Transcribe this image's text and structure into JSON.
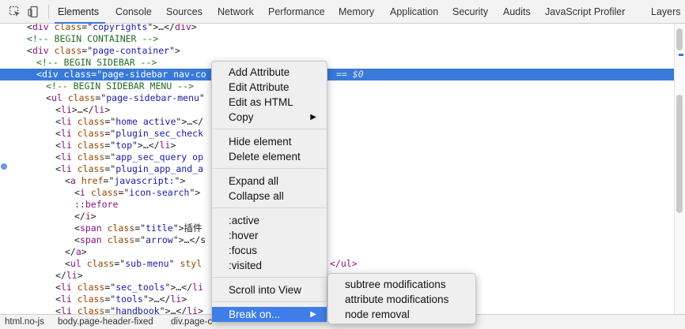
{
  "toolbar": {
    "tabs": [
      {
        "label": "Elements"
      },
      {
        "label": "Console"
      },
      {
        "label": "Sources"
      },
      {
        "label": "Network"
      },
      {
        "label": "Performance"
      },
      {
        "label": "Memory"
      },
      {
        "label": "Application"
      },
      {
        "label": "Security"
      },
      {
        "label": "Audits"
      },
      {
        "label": "JavaScript Profiler"
      },
      {
        "label": "Layers"
      }
    ],
    "active_tab": "Elements",
    "icons": [
      "inspect-element-icon",
      "device-toolbar-icon"
    ]
  },
  "tree": {
    "selected_suffix": "== $0",
    "lines": [
      {
        "tw": "▶",
        "parts": [
          [
            "p",
            "<"
          ],
          [
            "t",
            "div"
          ],
          [
            "p",
            " "
          ],
          [
            "a",
            "class"
          ],
          [
            "p",
            "=\""
          ],
          [
            "v",
            "copyrights"
          ],
          [
            "p",
            "\">…</"
          ],
          [
            "t",
            "div"
          ],
          [
            "p",
            ">"
          ]
        ]
      },
      {
        "tw": "",
        "parts": [
          [
            "c",
            "<!-- BEGIN CONTAINER -->"
          ]
        ]
      },
      {
        "tw": "▼",
        "parts": [
          [
            "p",
            "<"
          ],
          [
            "t",
            "div"
          ],
          [
            "p",
            " "
          ],
          [
            "a",
            "class"
          ],
          [
            "p",
            "=\""
          ],
          [
            "v",
            "page-container"
          ],
          [
            "p",
            "\">"
          ]
        ]
      },
      {
        "tw": "",
        "parts": [
          [
            "c",
            "<!-- BEGIN SIDEBAR -->"
          ]
        ]
      },
      {
        "tw": "▼",
        "parts": [
          [
            "p",
            "<"
          ],
          [
            "t",
            "div"
          ],
          [
            "p",
            " "
          ],
          [
            "a",
            "class"
          ],
          [
            "p",
            "=\""
          ],
          [
            "v",
            "page-sidebar nav-co"
          ]
        ]
      },
      {
        "tw": "",
        "parts": [
          [
            "c",
            "<!-- BEGIN SIDEBAR MENU -->"
          ]
        ]
      },
      {
        "tw": "▼",
        "parts": [
          [
            "p",
            "<"
          ],
          [
            "t",
            "ul"
          ],
          [
            "p",
            " "
          ],
          [
            "a",
            "class"
          ],
          [
            "p",
            "=\""
          ],
          [
            "v",
            "page-sidebar-menu"
          ],
          [
            "p",
            "\""
          ]
        ]
      },
      {
        "tw": "▶",
        "parts": [
          [
            "p",
            "<"
          ],
          [
            "t",
            "li"
          ],
          [
            "p",
            ">…</"
          ],
          [
            "t",
            "li"
          ],
          [
            "p",
            ">"
          ]
        ]
      },
      {
        "tw": "▶",
        "parts": [
          [
            "p",
            "<"
          ],
          [
            "t",
            "li"
          ],
          [
            "p",
            " "
          ],
          [
            "a",
            "class"
          ],
          [
            "p",
            "=\""
          ],
          [
            "v",
            "home active"
          ],
          [
            "p",
            "\">…</"
          ]
        ]
      },
      {
        "tw": "▶",
        "parts": [
          [
            "p",
            "<"
          ],
          [
            "t",
            "li"
          ],
          [
            "p",
            " "
          ],
          [
            "a",
            "class"
          ],
          [
            "p",
            "=\""
          ],
          [
            "v",
            "plugin_sec_check"
          ]
        ]
      },
      {
        "tw": "▶",
        "parts": [
          [
            "p",
            "<"
          ],
          [
            "t",
            "li"
          ],
          [
            "p",
            " "
          ],
          [
            "a",
            "class"
          ],
          [
            "p",
            "=\""
          ],
          [
            "v",
            "top"
          ],
          [
            "p",
            "\">…</"
          ],
          [
            "t",
            "li"
          ],
          [
            "p",
            ">"
          ]
        ]
      },
      {
        "tw": "▶",
        "parts": [
          [
            "p",
            "<"
          ],
          [
            "t",
            "li"
          ],
          [
            "p",
            " "
          ],
          [
            "a",
            "class"
          ],
          [
            "p",
            "=\""
          ],
          [
            "v",
            "app_sec_query op"
          ]
        ]
      },
      {
        "tw": "▼",
        "parts": [
          [
            "p",
            "<"
          ],
          [
            "t",
            "li"
          ],
          [
            "p",
            " "
          ],
          [
            "a",
            "class"
          ],
          [
            "p",
            "=\""
          ],
          [
            "v",
            "plugin_app_and_a"
          ]
        ]
      },
      {
        "tw": "▼",
        "parts": [
          [
            "p",
            "<"
          ],
          [
            "t",
            "a"
          ],
          [
            "p",
            " "
          ],
          [
            "a",
            "href"
          ],
          [
            "p",
            "=\""
          ],
          [
            "v",
            "javascript:"
          ],
          [
            "p",
            "\">"
          ]
        ]
      },
      {
        "tw": "▼",
        "parts": [
          [
            "p",
            "<"
          ],
          [
            "t",
            "i"
          ],
          [
            "p",
            " "
          ],
          [
            "a",
            "class"
          ],
          [
            "p",
            "=\""
          ],
          [
            "v",
            "icon-search"
          ],
          [
            "p",
            "\">"
          ]
        ]
      },
      {
        "tw": "",
        "parts": [
          [
            "s",
            "::before"
          ]
        ]
      },
      {
        "tw": "",
        "parts": [
          [
            "p",
            "</"
          ],
          [
            "t",
            "i"
          ],
          [
            "p",
            ">"
          ]
        ]
      },
      {
        "tw": "",
        "parts": [
          [
            "p",
            "<"
          ],
          [
            "t",
            "span"
          ],
          [
            "p",
            " "
          ],
          [
            "a",
            "class"
          ],
          [
            "p",
            "=\""
          ],
          [
            "v",
            "title"
          ],
          [
            "p",
            "\">插件"
          ]
        ]
      },
      {
        "tw": "▶",
        "parts": [
          [
            "p",
            "<"
          ],
          [
            "t",
            "span"
          ],
          [
            "p",
            " "
          ],
          [
            "a",
            "class"
          ],
          [
            "p",
            "=\""
          ],
          [
            "v",
            "arrow"
          ],
          [
            "p",
            "\">…</s"
          ]
        ]
      },
      {
        "tw": "",
        "parts": [
          [
            "p",
            "</"
          ],
          [
            "t",
            "a"
          ],
          [
            "p",
            ">"
          ]
        ]
      },
      {
        "tw": "▶",
        "parts": [
          [
            "p",
            "<"
          ],
          [
            "t",
            "ul"
          ],
          [
            "p",
            " "
          ],
          [
            "a",
            "class"
          ],
          [
            "p",
            "=\""
          ],
          [
            "v",
            "sub-menu"
          ],
          [
            "p",
            "\" "
          ],
          [
            "a",
            "styl"
          ]
        ]
      },
      {
        "tw": "",
        "parts": [
          [
            "p",
            "</"
          ],
          [
            "t",
            "li"
          ],
          [
            "p",
            ">"
          ]
        ]
      },
      {
        "tw": "▶",
        "parts": [
          [
            "p",
            "<"
          ],
          [
            "t",
            "li"
          ],
          [
            "p",
            " "
          ],
          [
            "a",
            "class"
          ],
          [
            "p",
            "=\""
          ],
          [
            "v",
            "sec_tools"
          ],
          [
            "p",
            "\">…</"
          ],
          [
            "t",
            "li"
          ]
        ]
      },
      {
        "tw": "▶",
        "parts": [
          [
            "p",
            "<"
          ],
          [
            "t",
            "li"
          ],
          [
            "p",
            " "
          ],
          [
            "a",
            "class"
          ],
          [
            "p",
            "=\""
          ],
          [
            "v",
            "tools"
          ],
          [
            "p",
            "\">…</"
          ],
          [
            "t",
            "li"
          ],
          [
            "p",
            ">"
          ]
        ]
      },
      {
        "tw": "▶",
        "parts": [
          [
            "p",
            "<"
          ],
          [
            "t",
            "li"
          ],
          [
            "p",
            " "
          ],
          [
            "a",
            "class"
          ],
          [
            "p",
            "=\""
          ],
          [
            "v",
            "handbook"
          ],
          [
            "p",
            "\">…</"
          ],
          [
            "t",
            "li"
          ],
          [
            "p",
            ">"
          ]
        ]
      }
    ],
    "right_fragments": [
      {
        "row": 0,
        "text": ""
      },
      {
        "row": 1,
        "text": ""
      },
      {
        "row": 2,
        "text": ""
      },
      {
        "row": 3,
        "text": ""
      },
      {
        "row": 4,
        "text": "== $0"
      },
      {
        "row": 5,
        "text": ""
      },
      {
        "row": 6,
        "text": ""
      },
      {
        "row": 7,
        "text": ""
      },
      {
        "row": 8,
        "text": ""
      },
      {
        "row": 9,
        "text": ""
      },
      {
        "row": 10,
        "text": ""
      },
      {
        "row": 11,
        "text": ""
      },
      {
        "row": 12,
        "text": ""
      },
      {
        "row": 13,
        "text": ""
      },
      {
        "row": 14,
        "text": ""
      },
      {
        "row": 15,
        "text": ""
      },
      {
        "row": 16,
        "text": ""
      },
      {
        "row": 17,
        "text": ""
      },
      {
        "row": 18,
        "text": ""
      },
      {
        "row": 19,
        "text": ""
      },
      {
        "row": 20,
        "text": "</ul>"
      },
      {
        "row": 21,
        "text": ""
      },
      {
        "row": 22,
        "text": ""
      },
      {
        "row": 23,
        "text": ""
      },
      {
        "row": 24,
        "text": ""
      }
    ]
  },
  "context_menu": {
    "groups": [
      [
        {
          "label": "Add Attribute"
        },
        {
          "label": "Edit Attribute"
        },
        {
          "label": "Edit as HTML"
        },
        {
          "label": "Copy",
          "submenu": true
        }
      ],
      [
        {
          "label": "Hide element"
        },
        {
          "label": "Delete element"
        }
      ],
      [
        {
          "label": "Expand all"
        },
        {
          "label": "Collapse all"
        }
      ],
      [
        {
          "label": ":active"
        },
        {
          "label": ":hover"
        },
        {
          "label": ":focus"
        },
        {
          "label": ":visited"
        }
      ],
      [
        {
          "label": "Scroll into View"
        }
      ],
      [
        {
          "label": "Break on...",
          "submenu": true,
          "highlighted": true
        }
      ]
    ]
  },
  "submenu": {
    "items": [
      {
        "label": "subtree modifications"
      },
      {
        "label": "attribute modifications"
      },
      {
        "label": "node removal"
      }
    ]
  },
  "breadcrumbs": [
    {
      "label": "html.no-js"
    },
    {
      "label": "body.page-header-fixed"
    },
    {
      "label": "div.page-c"
    }
  ],
  "colors": {
    "selection": "#3879d9",
    "menu_highlight": "#3f7ee8",
    "tag": "#881280",
    "attribute": "#994500",
    "value": "#1a1aa6",
    "comment": "#236e25"
  }
}
